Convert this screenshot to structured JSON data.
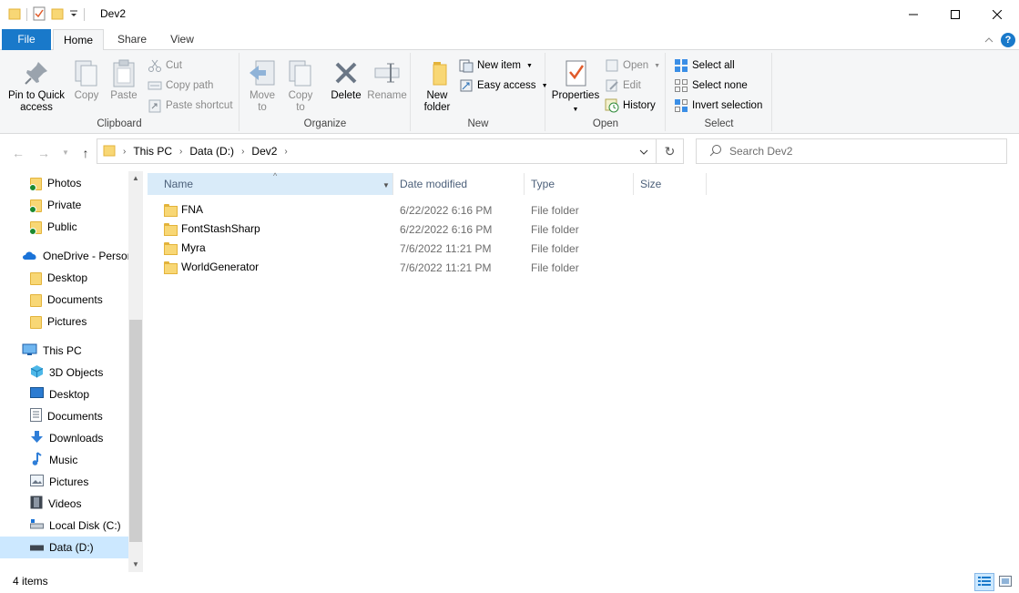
{
  "window": {
    "title": "Dev2",
    "minimize_glyph": "─",
    "maximize_glyph": "☐",
    "close_glyph": "✕"
  },
  "tabs": {
    "file": "File",
    "home": "Home",
    "share": "Share",
    "view": "View"
  },
  "ribbon": {
    "clipboard": {
      "label": "Clipboard",
      "pin_line1": "Pin to Quick",
      "pin_line2": "access",
      "copy": "Copy",
      "paste": "Paste",
      "cut": "Cut",
      "copy_path": "Copy path",
      "paste_shortcut": "Paste shortcut"
    },
    "organize": {
      "label": "Organize",
      "move_line1": "Move",
      "move_line2": "to",
      "copy_line1": "Copy",
      "copy_line2": "to",
      "delete": "Delete",
      "rename": "Rename"
    },
    "new": {
      "label": "New",
      "folder_line1": "New",
      "folder_line2": "folder",
      "new_item": "New item",
      "easy_access": "Easy access"
    },
    "open": {
      "label": "Open",
      "properties": "Properties",
      "open": "Open",
      "edit": "Edit",
      "history": "History"
    },
    "select": {
      "label": "Select",
      "select_all": "Select all",
      "select_none": "Select none",
      "invert": "Invert selection"
    }
  },
  "address": {
    "crumbs": [
      "This PC",
      "Data (D:)",
      "Dev2"
    ],
    "search_placeholder": "Search Dev2"
  },
  "nav": {
    "items": [
      {
        "label": "Photos",
        "icon": "folder-synced-icon"
      },
      {
        "label": "Private",
        "icon": "folder-synced-icon"
      },
      {
        "label": "Public",
        "icon": "folder-synced-icon"
      },
      {
        "label": "OneDrive - Persor",
        "icon": "onedrive-cloud-icon"
      },
      {
        "label": "Desktop",
        "icon": "folder-icon"
      },
      {
        "label": "Documents",
        "icon": "folder-icon"
      },
      {
        "label": "Pictures",
        "icon": "folder-icon"
      },
      {
        "label": "This PC",
        "icon": "monitor-icon"
      },
      {
        "label": "3D Objects",
        "icon": "cube-icon"
      },
      {
        "label": "Desktop",
        "icon": "desktop-icon"
      },
      {
        "label": "Documents",
        "icon": "document-icon"
      },
      {
        "label": "Downloads",
        "icon": "download-arrow-icon"
      },
      {
        "label": "Music",
        "icon": "music-note-icon"
      },
      {
        "label": "Pictures",
        "icon": "pictures-icon"
      },
      {
        "label": "Videos",
        "icon": "film-icon"
      },
      {
        "label": "Local Disk (C:)",
        "icon": "drive-icon"
      },
      {
        "label": "Data (D:)",
        "icon": "drive-icon"
      }
    ]
  },
  "columns": {
    "name": "Name",
    "date": "Date modified",
    "type": "Type",
    "size": "Size"
  },
  "files": [
    {
      "name": "FNA",
      "date": "6/22/2022 6:16 PM",
      "type": "File folder"
    },
    {
      "name": "FontStashSharp",
      "date": "6/22/2022 6:16 PM",
      "type": "File folder"
    },
    {
      "name": "Myra",
      "date": "7/6/2022 11:21 PM",
      "type": "File folder"
    },
    {
      "name": "WorldGenerator",
      "date": "7/6/2022 11:21 PM",
      "type": "File folder"
    }
  ],
  "status": {
    "item_count": "4 items"
  },
  "colors": {
    "accent": "#1979ca",
    "selection": "#cce8ff",
    "folder": "#f8d775"
  }
}
